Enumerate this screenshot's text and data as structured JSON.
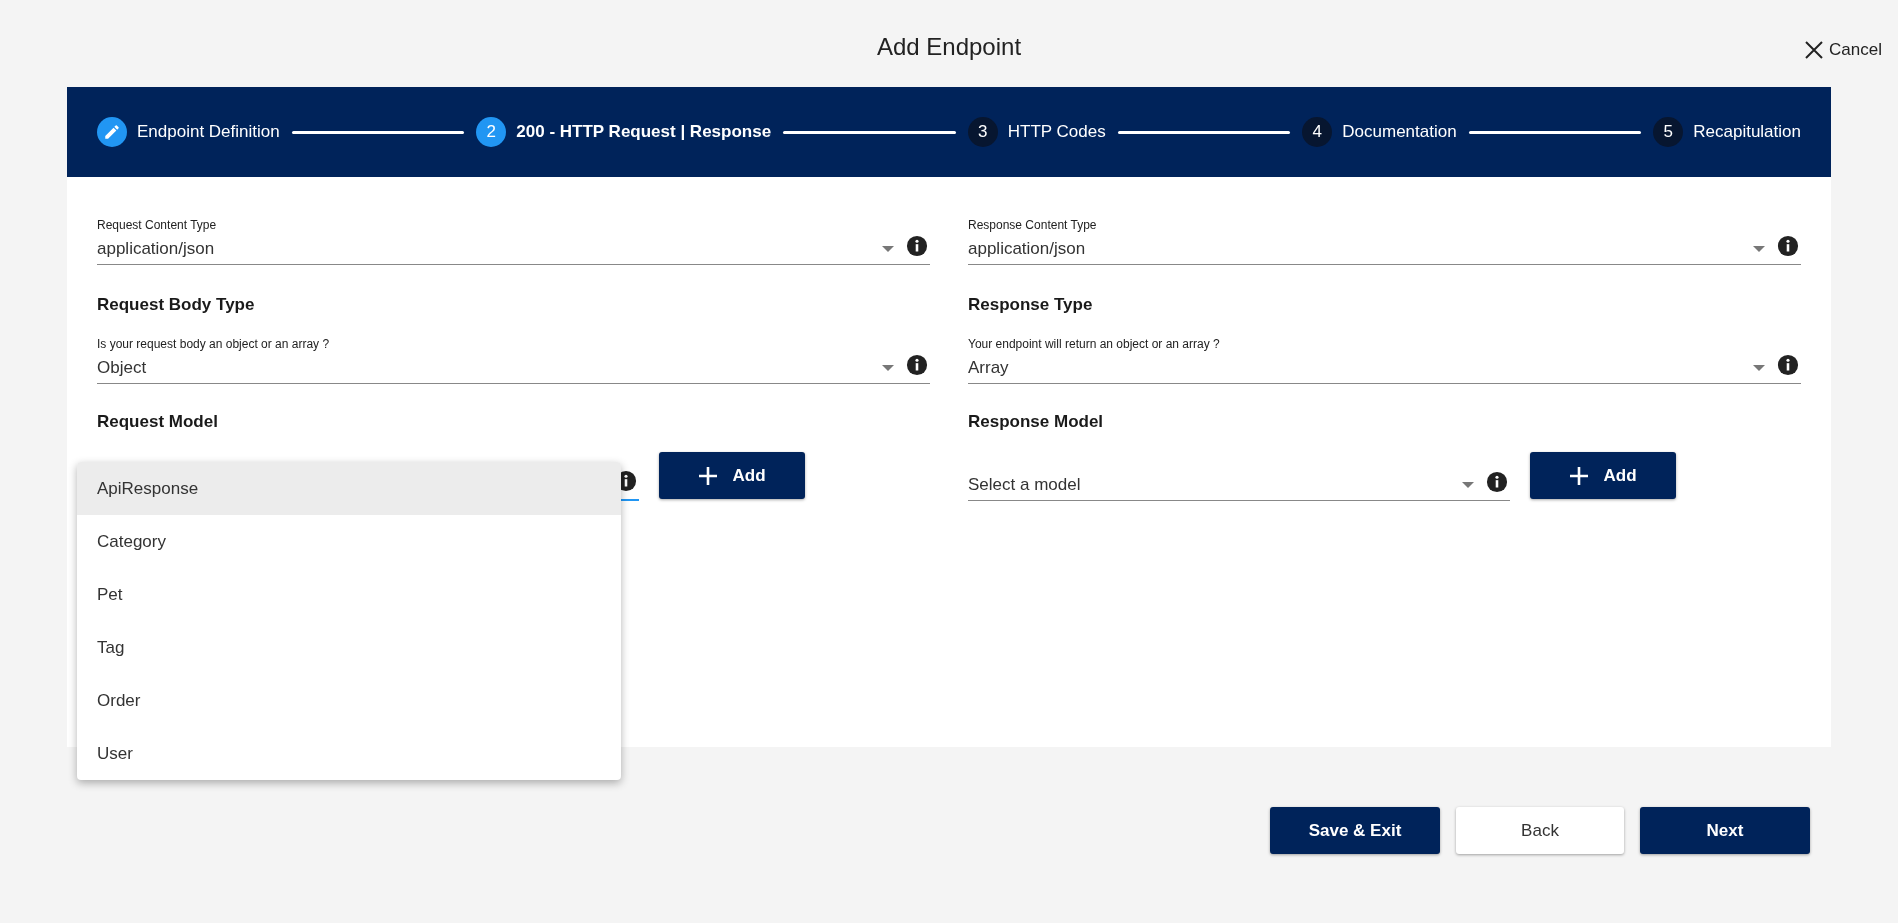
{
  "dialog": {
    "title": "Add Endpoint",
    "cancel": "Cancel"
  },
  "stepper": [
    {
      "kind": "done",
      "label": "Endpoint Definition",
      "selected": false
    },
    {
      "kind": "number",
      "number": "2",
      "label": "200 - HTTP Request | Response",
      "selected": true
    },
    {
      "kind": "number",
      "number": "3",
      "label": "HTTP Codes",
      "selected": false
    },
    {
      "kind": "number",
      "number": "4",
      "label": "Documentation",
      "selected": false
    },
    {
      "kind": "number",
      "number": "5",
      "label": "Recapitulation",
      "selected": false
    }
  ],
  "columns": [
    {
      "content_type": {
        "label": "Request Content Type",
        "value": "application/json"
      },
      "body_type": {
        "heading": "Request Body Type",
        "label": "Is your request body an object or an array ?",
        "value": "Object"
      },
      "model": {
        "heading": "Request Model",
        "focused": true,
        "add_button": "Add",
        "dropdown": {
          "options": [
            {
              "label": "ApiResponse",
              "selected": true
            },
            {
              "label": "Category",
              "selected": false
            },
            {
              "label": "Pet",
              "selected": false
            },
            {
              "label": "Tag",
              "selected": false
            },
            {
              "label": "Order",
              "selected": false
            },
            {
              "label": "User",
              "selected": false
            }
          ]
        }
      }
    },
    {
      "content_type": {
        "label": "Response Content Type",
        "value": "application/json"
      },
      "body_type": {
        "heading": "Response Type",
        "label": "Your endpoint will return an object or an array ?",
        "value": "Array"
      },
      "model": {
        "heading": "Response Model",
        "placeholder": "Select a model",
        "focused": false,
        "add_button": "Add"
      }
    }
  ],
  "footer_buttons": [
    {
      "label": "Save & Exit",
      "kind": "primary"
    },
    {
      "label": "Back",
      "kind": "secondary"
    },
    {
      "label": "Next",
      "kind": "primary"
    }
  ]
}
